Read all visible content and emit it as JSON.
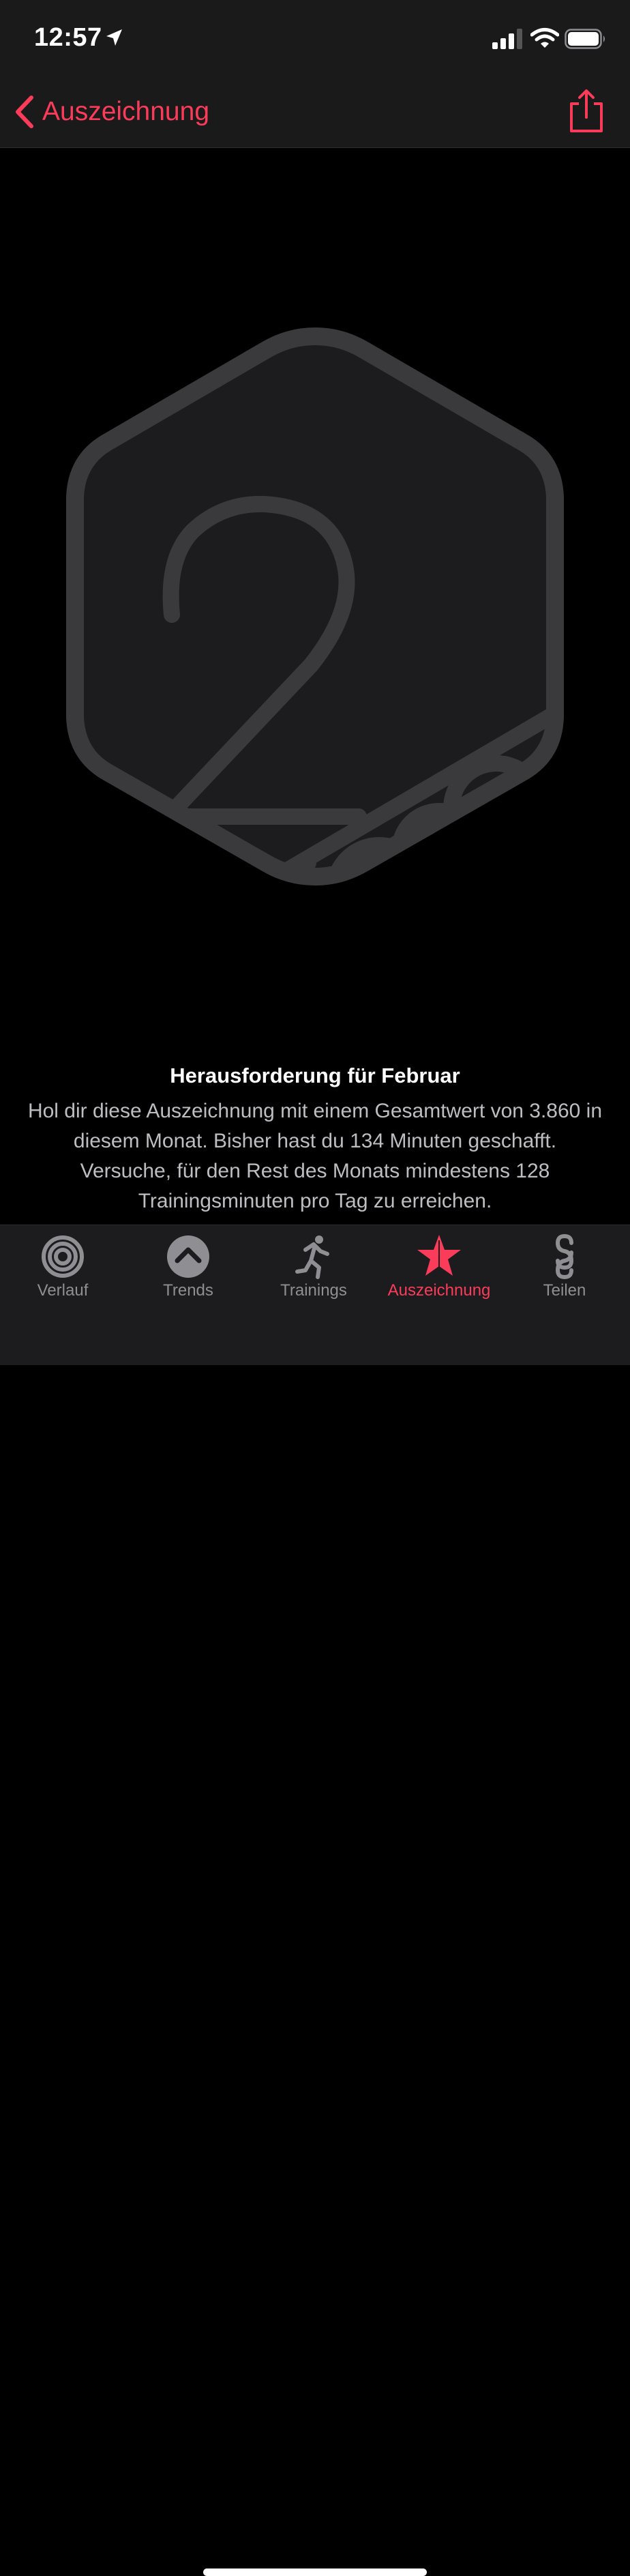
{
  "status_bar": {
    "time": "12:57"
  },
  "nav": {
    "back_label": "Auszeichnung"
  },
  "award": {
    "title": "Herausforderung für Februar",
    "description": "Hol dir diese Auszeichnung mit einem Gesamtwert von 3.860 in diesem Monat. Bisher hast du 134 Minuten geschafft. Versuche, für den Rest des Monats mindestens 128 Trainingsminuten pro Tag zu erreichen."
  },
  "tabs": [
    {
      "label": "Verlauf",
      "icon": "activity-rings-icon"
    },
    {
      "label": "Trends",
      "icon": "trends-chevron-icon"
    },
    {
      "label": "Trainings",
      "icon": "running-figure-icon"
    },
    {
      "label": "Auszeichnung",
      "icon": "award-star-icon",
      "active": true
    },
    {
      "label": "Teilen",
      "icon": "sharing-icon"
    }
  ],
  "colors": {
    "accent": "#fa3c5a",
    "badge": "#3a3a3c",
    "inactive": "#8e8e93"
  }
}
